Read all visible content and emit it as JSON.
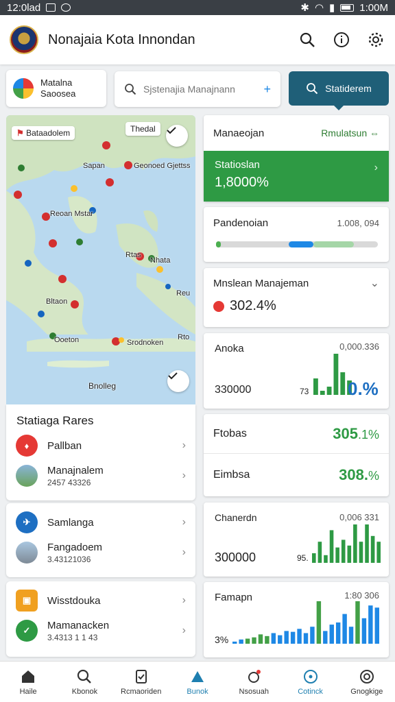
{
  "status_bar": {
    "time": "12:0lad",
    "clock": "1:00M"
  },
  "app_bar": {
    "title": "Nonajaia Kota Innondan"
  },
  "chip": {
    "line1": "Matalna",
    "line2": "Saoosea"
  },
  "search": {
    "placeholder": "Sjstenajia Manajnann"
  },
  "primary_button": {
    "label": "Statiderem"
  },
  "map": {
    "legend_chip": "Bataadolem",
    "layer_chip": "Thedal",
    "bottom_label": "Bnolleg",
    "labels": [
      "Sapan",
      "Geonoed Gjettss",
      "Reoan Mstar",
      "Rtas",
      "Nhata",
      "Bltaon",
      "Ooeton",
      "Srodnoken",
      "Rto",
      "Reu"
    ]
  },
  "left_list_1": {
    "title": "Statiaga Rares",
    "items": [
      {
        "title": "Pallban",
        "subtitle": ""
      },
      {
        "title": "Manajnalem",
        "subtitle": "2457 43326"
      }
    ]
  },
  "left_list_2": {
    "items": [
      {
        "title": "Samlanga",
        "subtitle": ""
      },
      {
        "title": "Fangadoem",
        "subtitle": "3.43121036"
      }
    ]
  },
  "left_list_3": {
    "items": [
      {
        "title": "Wisstdouka",
        "subtitle": ""
      },
      {
        "title": "Mamanacken",
        "subtitle": "3.4313 1 1 43"
      }
    ]
  },
  "card_manaeojan": {
    "title": "Manaeojan",
    "link": "Rmulatsun",
    "band_label": "Statioslan",
    "band_value": "1,8000%",
    "colors": {
      "band": "#2e9a44"
    }
  },
  "card_pandenoian": {
    "title": "Pandenoian",
    "value": "1.008, 094",
    "progress": [
      {
        "start": 0.0,
        "end": 0.03,
        "color": "#4caf50"
      },
      {
        "start": 0.45,
        "end": 0.6,
        "color": "#1e88e5"
      },
      {
        "start": 0.6,
        "end": 0.85,
        "color": "#a5d6a7"
      }
    ]
  },
  "card_mnslean": {
    "title": "Mnslean Manajeman",
    "value": "302.4%"
  },
  "card_anoka": {
    "title": "Anoka",
    "top_value": "0,000.336",
    "left_value": "330000",
    "small_value": "73",
    "big_value": "0.%",
    "bars": [
      0.4,
      0.1,
      0.2,
      1.0,
      0.55,
      0.35
    ]
  },
  "card_ftobas": {
    "rows": [
      {
        "label": "Ftobas",
        "value": "305",
        "suffix": ".1%"
      },
      {
        "label": "Eimbsa",
        "value": "308.",
        "suffix": "%"
      }
    ]
  },
  "card_chanerdn": {
    "title": "Chanerdn",
    "top_value": "0,006 331",
    "left_value": "300000",
    "small_value": "95.",
    "bars": [
      0.25,
      0.55,
      0.2,
      0.85,
      0.4,
      0.6,
      0.45,
      1.0,
      0.55,
      1.0,
      0.7,
      0.55
    ]
  },
  "card_famapn": {
    "title": "Famapn",
    "top_value": "1:80 306",
    "left_value": "3%",
    "bars": [
      {
        "v": 0.05,
        "c": "#1e88e5"
      },
      {
        "v": 0.1,
        "c": "#1e88e5"
      },
      {
        "v": 0.12,
        "c": "#43a047"
      },
      {
        "v": 0.15,
        "c": "#43a047"
      },
      {
        "v": 0.22,
        "c": "#43a047"
      },
      {
        "v": 0.18,
        "c": "#43a047"
      },
      {
        "v": 0.25,
        "c": "#1e88e5"
      },
      {
        "v": 0.2,
        "c": "#1e88e5"
      },
      {
        "v": 0.3,
        "c": "#1e88e5"
      },
      {
        "v": 0.28,
        "c": "#1e88e5"
      },
      {
        "v": 0.35,
        "c": "#1e88e5"
      },
      {
        "v": 0.25,
        "c": "#1e88e5"
      },
      {
        "v": 0.4,
        "c": "#1e88e5"
      },
      {
        "v": 1.0,
        "c": "#43a047"
      },
      {
        "v": 0.3,
        "c": "#1e88e5"
      },
      {
        "v": 0.45,
        "c": "#1e88e5"
      },
      {
        "v": 0.5,
        "c": "#1e88e5"
      },
      {
        "v": 0.7,
        "c": "#1e88e5"
      },
      {
        "v": 0.4,
        "c": "#1e88e5"
      },
      {
        "v": 1.0,
        "c": "#43a047"
      },
      {
        "v": 0.6,
        "c": "#1e88e5"
      },
      {
        "v": 0.9,
        "c": "#1e88e5"
      },
      {
        "v": 0.85,
        "c": "#1e88e5"
      }
    ]
  },
  "bottom_nav": [
    {
      "label": "Haile",
      "icon": "home-icon"
    },
    {
      "label": "Kbonok",
      "icon": "search-icon"
    },
    {
      "label": "Rcmaoriden",
      "icon": "document-icon"
    },
    {
      "label": "Bunok",
      "icon": "chart-icon"
    },
    {
      "label": "Nsosuah",
      "icon": "notification-icon"
    },
    {
      "label": "Cotinck",
      "icon": "target-icon"
    },
    {
      "label": "Gnogkige",
      "icon": "settings-icon"
    }
  ]
}
